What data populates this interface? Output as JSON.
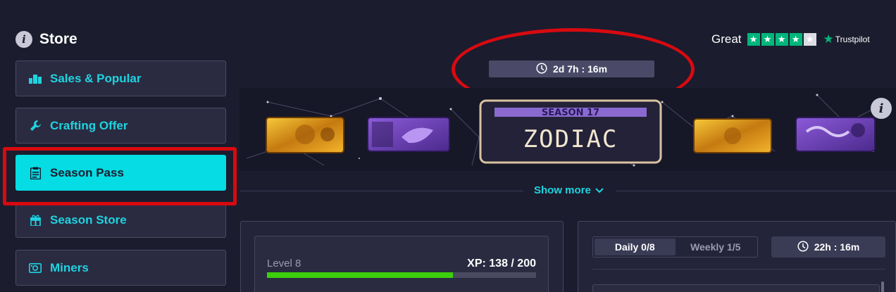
{
  "sidebar": {
    "title": "Store",
    "items": [
      {
        "label": "Sales & Popular",
        "icon": "podium-icon"
      },
      {
        "label": "Crafting Offer",
        "icon": "wrench-icon"
      },
      {
        "label": "Season Pass",
        "icon": "clipboard-icon",
        "active": true
      },
      {
        "label": "Season Store",
        "icon": "gift-icon"
      },
      {
        "label": "Miners",
        "icon": "miner-icon"
      }
    ]
  },
  "header": {
    "timer": "2d 7h : 16m",
    "rating": {
      "word": "Great",
      "stars_filled": 4,
      "stars_total": 5,
      "brand": "Trustpilot"
    }
  },
  "banner": {
    "season_label": "SEASON 17",
    "season_name": "ZODIAC",
    "show_more": "Show more"
  },
  "progress": {
    "level": "Level 8",
    "xp": "XP: 138 / 200",
    "fraction": 0.69
  },
  "tasks": {
    "tabs": [
      {
        "label": "Daily 0/8",
        "active": true
      },
      {
        "label": "Weekly 1/5",
        "active": false
      }
    ],
    "timer": "22h : 16m"
  },
  "colors": {
    "accent": "#05dce3",
    "background": "#1b1c2e",
    "progress": "#3ccf0c",
    "annotation": "#d70a10",
    "trustpilot": "#00b67a"
  }
}
